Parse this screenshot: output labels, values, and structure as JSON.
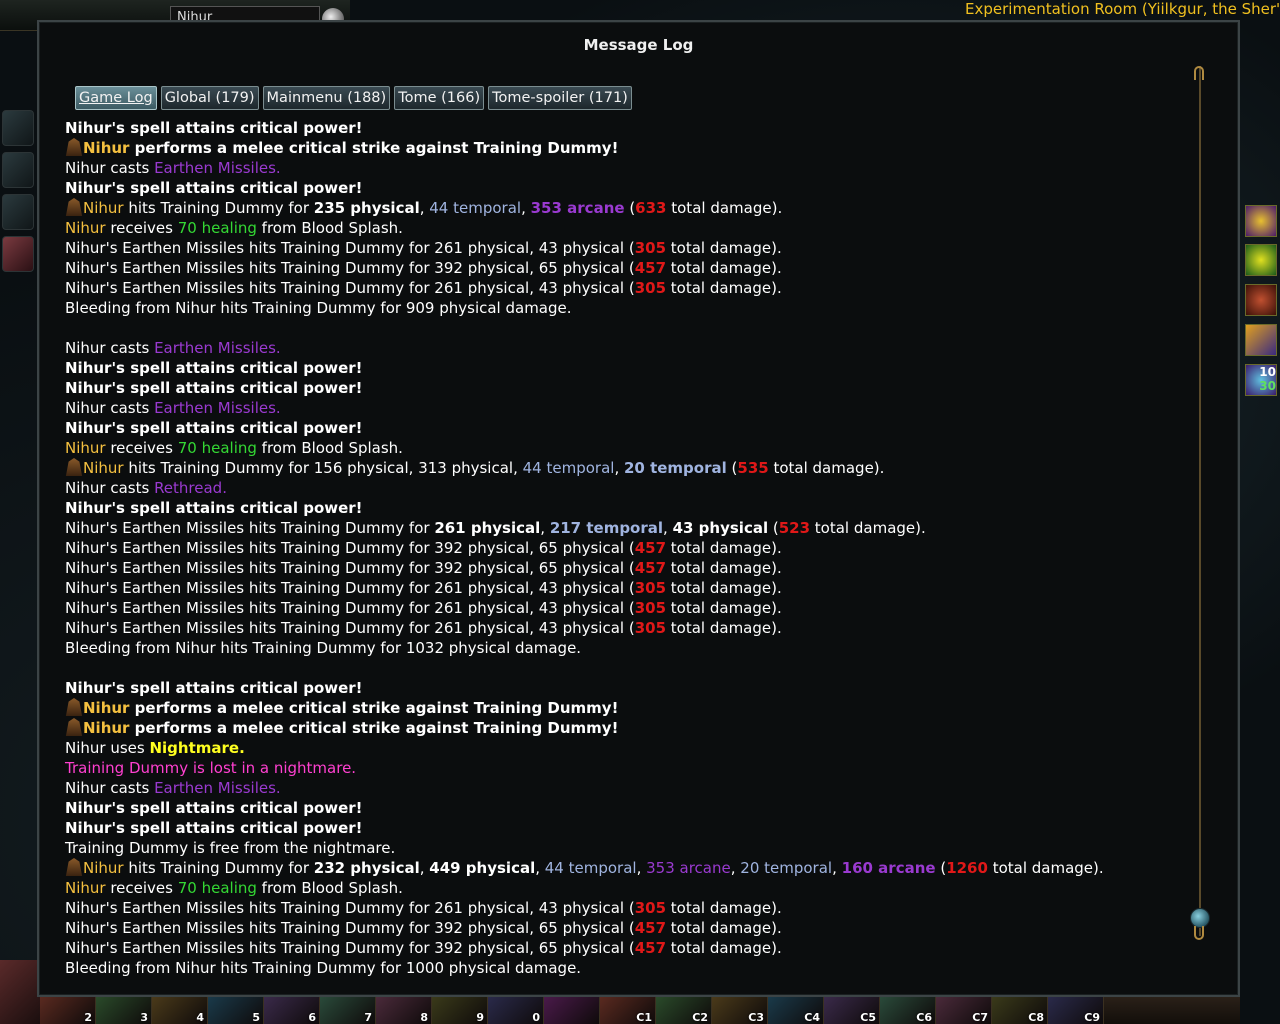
{
  "hud": {
    "player_name": "Nihur",
    "zone_title": "Experimentation Room (Yiilkgur, the Sher'T"
  },
  "log": {
    "title": "Message Log",
    "tabs": [
      {
        "label": "Game Log",
        "active": true
      },
      {
        "label": "Global (179)",
        "active": false
      },
      {
        "label": "Mainmenu (188)",
        "active": false
      },
      {
        "label": "Tome (166)",
        "active": false
      },
      {
        "label": "Tome-spoiler (171)",
        "active": false
      }
    ],
    "lines": [
      {
        "segs": [
          {
            "t": "Nihur's spell attains critical power!",
            "c": "bold"
          }
        ]
      },
      {
        "avatar": true,
        "segs": [
          {
            "t": "Nihur",
            "c": "orange bold"
          },
          {
            "t": " performs a melee critical strike against Training Dummy!",
            "c": "bold"
          }
        ]
      },
      {
        "segs": [
          {
            "t": "Nihur casts ",
            "c": ""
          },
          {
            "t": "Earthen Missiles.",
            "c": "purple"
          }
        ]
      },
      {
        "segs": [
          {
            "t": "Nihur's spell attains critical power!",
            "c": "bold"
          }
        ]
      },
      {
        "avatar": true,
        "segs": [
          {
            "t": "Nihur",
            "c": "orange"
          },
          {
            "t": " hits Training Dummy for ",
            "c": ""
          },
          {
            "t": "235 physical",
            "c": "bold"
          },
          {
            "t": ", ",
            "c": ""
          },
          {
            "t": "44 temporal",
            "c": "blue"
          },
          {
            "t": ", ",
            "c": ""
          },
          {
            "t": "353 arcane",
            "c": "purple bold"
          },
          {
            "t": " (",
            "c": ""
          },
          {
            "t": "633",
            "c": "red"
          },
          {
            "t": " total damage).",
            "c": ""
          }
        ]
      },
      {
        "segs": [
          {
            "t": "Nihur",
            "c": "orange"
          },
          {
            "t": " receives ",
            "c": ""
          },
          {
            "t": "70 healing",
            "c": "green"
          },
          {
            "t": " from Blood Splash.",
            "c": ""
          }
        ]
      },
      {
        "segs": [
          {
            "t": "Nihur's Earthen Missiles hits Training Dummy for 261 physical, 43 physical (",
            "c": ""
          },
          {
            "t": "305",
            "c": "red"
          },
          {
            "t": " total damage).",
            "c": ""
          }
        ]
      },
      {
        "segs": [
          {
            "t": "Nihur's Earthen Missiles hits Training Dummy for 392 physical, 65 physical (",
            "c": ""
          },
          {
            "t": "457",
            "c": "red"
          },
          {
            "t": " total damage).",
            "c": ""
          }
        ]
      },
      {
        "segs": [
          {
            "t": "Nihur's Earthen Missiles hits Training Dummy for 261 physical, 43 physical (",
            "c": ""
          },
          {
            "t": "305",
            "c": "red"
          },
          {
            "t": " total damage).",
            "c": ""
          }
        ]
      },
      {
        "segs": [
          {
            "t": "Bleeding from Nihur hits Training Dummy for 909 physical damage.",
            "c": ""
          }
        ]
      },
      {
        "segs": []
      },
      {
        "segs": [
          {
            "t": "Nihur casts ",
            "c": ""
          },
          {
            "t": "Earthen Missiles.",
            "c": "purple"
          }
        ]
      },
      {
        "segs": [
          {
            "t": "Nihur's spell attains critical power!",
            "c": "bold"
          }
        ]
      },
      {
        "segs": [
          {
            "t": "Nihur's spell attains critical power!",
            "c": "bold"
          }
        ]
      },
      {
        "segs": [
          {
            "t": "Nihur casts ",
            "c": ""
          },
          {
            "t": "Earthen Missiles.",
            "c": "purple"
          }
        ]
      },
      {
        "segs": [
          {
            "t": "Nihur's spell attains critical power!",
            "c": "bold"
          }
        ]
      },
      {
        "segs": [
          {
            "t": "Nihur",
            "c": "orange"
          },
          {
            "t": " receives ",
            "c": ""
          },
          {
            "t": "70 healing",
            "c": "green"
          },
          {
            "t": " from Blood Splash.",
            "c": ""
          }
        ]
      },
      {
        "avatar": true,
        "segs": [
          {
            "t": "Nihur",
            "c": "orange"
          },
          {
            "t": " hits Training Dummy for 156 physical, 313 physical, ",
            "c": ""
          },
          {
            "t": "44 temporal",
            "c": "blue"
          },
          {
            "t": ", ",
            "c": ""
          },
          {
            "t": "20 temporal",
            "c": "blue bold"
          },
          {
            "t": " (",
            "c": ""
          },
          {
            "t": "535",
            "c": "red"
          },
          {
            "t": " total damage).",
            "c": ""
          }
        ]
      },
      {
        "segs": [
          {
            "t": "Nihur casts ",
            "c": ""
          },
          {
            "t": "Rethread.",
            "c": "purple"
          }
        ]
      },
      {
        "segs": [
          {
            "t": "Nihur's spell attains critical power!",
            "c": "bold"
          }
        ]
      },
      {
        "segs": [
          {
            "t": "Nihur's Earthen Missiles hits Training Dummy for ",
            "c": ""
          },
          {
            "t": "261 physical",
            "c": "bold"
          },
          {
            "t": ", ",
            "c": ""
          },
          {
            "t": "217 temporal",
            "c": "blue bold"
          },
          {
            "t": ", ",
            "c": ""
          },
          {
            "t": "43 physical",
            "c": "bold"
          },
          {
            "t": " (",
            "c": ""
          },
          {
            "t": "523",
            "c": "red"
          },
          {
            "t": " total damage).",
            "c": ""
          }
        ]
      },
      {
        "segs": [
          {
            "t": "Nihur's Earthen Missiles hits Training Dummy for 392 physical, 65 physical (",
            "c": ""
          },
          {
            "t": "457",
            "c": "red"
          },
          {
            "t": " total damage).",
            "c": ""
          }
        ]
      },
      {
        "segs": [
          {
            "t": "Nihur's Earthen Missiles hits Training Dummy for 392 physical, 65 physical (",
            "c": ""
          },
          {
            "t": "457",
            "c": "red"
          },
          {
            "t": " total damage).",
            "c": ""
          }
        ]
      },
      {
        "segs": [
          {
            "t": "Nihur's Earthen Missiles hits Training Dummy for 261 physical, 43 physical (",
            "c": ""
          },
          {
            "t": "305",
            "c": "red"
          },
          {
            "t": " total damage).",
            "c": ""
          }
        ]
      },
      {
        "segs": [
          {
            "t": "Nihur's Earthen Missiles hits Training Dummy for 261 physical, 43 physical (",
            "c": ""
          },
          {
            "t": "305",
            "c": "red"
          },
          {
            "t": " total damage).",
            "c": ""
          }
        ]
      },
      {
        "segs": [
          {
            "t": "Nihur's Earthen Missiles hits Training Dummy for 261 physical, 43 physical (",
            "c": ""
          },
          {
            "t": "305",
            "c": "red"
          },
          {
            "t": " total damage).",
            "c": ""
          }
        ]
      },
      {
        "segs": [
          {
            "t": "Bleeding from Nihur hits Training Dummy for 1032 physical damage.",
            "c": ""
          }
        ]
      },
      {
        "segs": []
      },
      {
        "segs": [
          {
            "t": "Nihur's spell attains critical power!",
            "c": "bold"
          }
        ]
      },
      {
        "avatar": true,
        "segs": [
          {
            "t": "Nihur",
            "c": "orange bold"
          },
          {
            "t": " performs a melee critical strike against Training Dummy!",
            "c": "bold"
          }
        ]
      },
      {
        "avatar": true,
        "segs": [
          {
            "t": "Nihur",
            "c": "orange bold"
          },
          {
            "t": " performs a melee critical strike against Training Dummy!",
            "c": "bold"
          }
        ]
      },
      {
        "segs": [
          {
            "t": "Nihur uses ",
            "c": ""
          },
          {
            "t": "Nightmare.",
            "c": "yellow bold"
          }
        ]
      },
      {
        "segs": [
          {
            "t": "Training Dummy is lost in a nightmare.",
            "c": "pink"
          }
        ]
      },
      {
        "segs": [
          {
            "t": "Nihur casts ",
            "c": ""
          },
          {
            "t": "Earthen Missiles.",
            "c": "purple"
          }
        ]
      },
      {
        "segs": [
          {
            "t": "Nihur's spell attains critical power!",
            "c": "bold"
          }
        ]
      },
      {
        "segs": [
          {
            "t": "Nihur's spell attains critical power!",
            "c": "bold"
          }
        ]
      },
      {
        "segs": [
          {
            "t": "Training Dummy is free from the nightmare.",
            "c": ""
          }
        ]
      },
      {
        "avatar": true,
        "segs": [
          {
            "t": "Nihur",
            "c": "orange"
          },
          {
            "t": " hits Training Dummy for ",
            "c": ""
          },
          {
            "t": "232 physical",
            "c": "bold"
          },
          {
            "t": ", ",
            "c": ""
          },
          {
            "t": "449 physical",
            "c": "bold"
          },
          {
            "t": ", ",
            "c": ""
          },
          {
            "t": "44 temporal",
            "c": "blue"
          },
          {
            "t": ", ",
            "c": ""
          },
          {
            "t": "353 arcane",
            "c": "purple"
          },
          {
            "t": ", ",
            "c": ""
          },
          {
            "t": "20 temporal",
            "c": "blue"
          },
          {
            "t": ", ",
            "c": ""
          },
          {
            "t": "160 arcane",
            "c": "purple bold"
          },
          {
            "t": " (",
            "c": ""
          },
          {
            "t": "1260",
            "c": "red"
          },
          {
            "t": " total damage).",
            "c": ""
          }
        ]
      },
      {
        "segs": [
          {
            "t": "Nihur",
            "c": "orange"
          },
          {
            "t": " receives ",
            "c": ""
          },
          {
            "t": "70 healing",
            "c": "green"
          },
          {
            "t": " from Blood Splash.",
            "c": ""
          }
        ]
      },
      {
        "segs": [
          {
            "t": "Nihur's Earthen Missiles hits Training Dummy for 261 physical, 43 physical (",
            "c": ""
          },
          {
            "t": "305",
            "c": "red"
          },
          {
            "t": " total damage).",
            "c": ""
          }
        ]
      },
      {
        "segs": [
          {
            "t": "Nihur's Earthen Missiles hits Training Dummy for 392 physical, 65 physical (",
            "c": ""
          },
          {
            "t": "457",
            "c": "red"
          },
          {
            "t": " total damage).",
            "c": ""
          }
        ]
      },
      {
        "segs": [
          {
            "t": "Nihur's Earthen Missiles hits Training Dummy for 392 physical, 65 physical (",
            "c": ""
          },
          {
            "t": "457",
            "c": "red"
          },
          {
            "t": " total damage).",
            "c": ""
          }
        ]
      },
      {
        "segs": [
          {
            "t": "Bleeding from Nihur hits Training Dummy for 1000 physical damage.",
            "c": ""
          }
        ]
      }
    ]
  },
  "right_bar": {
    "counter_badge": "10",
    "counter_badge_2": "30"
  },
  "hotbar": {
    "slots": [
      "2",
      "3",
      "4",
      "5",
      "6",
      "7",
      "8",
      "9",
      "0",
      "",
      "C1",
      "C2",
      "C3",
      "C4",
      "C5",
      "C6",
      "C7",
      "C8",
      "C9"
    ]
  },
  "colors": {
    "zone_title": "#f0c020",
    "critical_text": "#ffffff",
    "player_name": "#f4c040",
    "spell_name": "#9a3ad0",
    "healing": "#34d834",
    "temporal": "#a0b4e0",
    "total_damage": "#e01818",
    "nightmare": "#ffff20",
    "status_pink": "#ff40d0"
  }
}
